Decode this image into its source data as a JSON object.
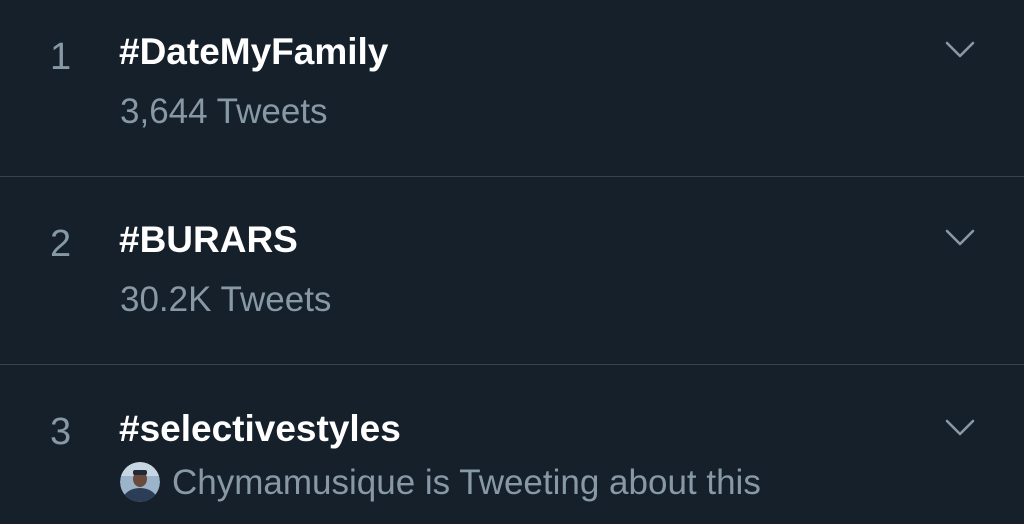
{
  "trends": [
    {
      "rank": "1",
      "hashtag": "#DateMyFamily",
      "meta": "3,644 Tweets",
      "icon": "chevron-down-icon"
    },
    {
      "rank": "2",
      "hashtag": "#BURARS",
      "meta": "30.2K Tweets",
      "icon": "chevron-down-icon"
    },
    {
      "rank": "3",
      "hashtag": "#selectivestyles",
      "meta": "Chymamusique is Tweeting about this",
      "icon": "chevron-down-icon",
      "avatar_icon": "user-avatar-icon"
    }
  ],
  "colors": {
    "background": "#15202b",
    "divider": "#38444d",
    "secondary_text": "#8899a6",
    "primary_text": "#ffffff"
  }
}
